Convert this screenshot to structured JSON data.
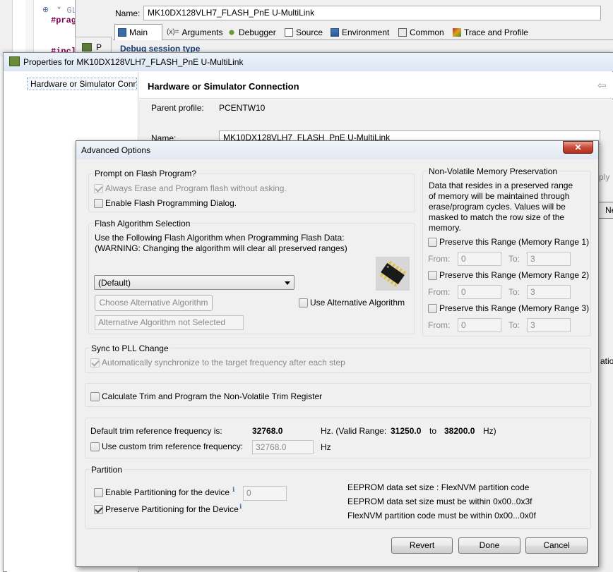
{
  "bg_editor": {
    "line1": "* GLOBAL.",
    "line2": "#pragma on",
    "line3": "#incl"
  },
  "launch_config": {
    "name_label": "Name:",
    "name_value": "MK10DX128VLH7_FLASH_PnE U-MultiLink",
    "tabs": [
      {
        "label": "Main",
        "icon": "main-tab-icon"
      },
      {
        "label": "Arguments",
        "icon": "arguments-icon"
      },
      {
        "label": "Debugger",
        "icon": "debugger-bug-icon"
      },
      {
        "label": "Source",
        "icon": "source-icon"
      },
      {
        "label": "Environment",
        "icon": "environment-icon"
      },
      {
        "label": "Common",
        "icon": "common-icon"
      },
      {
        "label": "Trace and Profile",
        "icon": "trace-icon"
      }
    ],
    "section_title": "Debug session type",
    "small_letter": "P"
  },
  "properties": {
    "title": "Properties for MK10DX128VLH7_FLASH_PnE U-MultiLink",
    "tree_item": "Hardware or Simulator Conn",
    "heading": "Hardware or Simulator Connection",
    "parent_profile_label": "Parent profile:",
    "parent_profile_value": "PCENTW10",
    "name_label": "Name:",
    "name_value": "MK10DX128VLH7_FLASH_PnE U-MultiLink",
    "right_edge_1": "ply",
    "right_edge_2": "Ne",
    "right_edge_3": "atio"
  },
  "dialog": {
    "title": "Advanced Options",
    "close_glyph": "✕",
    "prompt": {
      "title": "Prompt on Flash Program?",
      "always_erase": "Always Erase and Program flash without asking.",
      "enable_dialog": "Enable Flash Programming Dialog."
    },
    "algorithm": {
      "title": "Flash Algorithm Selection",
      "desc1": "Use the Following Flash Algorithm when Programming Flash Data:",
      "desc2": "(WARNING: Changing the algorithm will clear all preserved ranges)",
      "select_value": "(Default)",
      "choose_button": "Choose Alternative Algorithm",
      "use_alt": "Use Alternative Algorithm",
      "not_selected": "Alternative Algorithm not Selected"
    },
    "nvm": {
      "title": "Non-Volatile Memory Preservation",
      "desc": [
        "Data that resides in a preserved range",
        "of memory will be maintained through",
        "erase/program cycles. Values will be",
        "masked to match the row size of the",
        "memory."
      ],
      "ranges": [
        {
          "label": "Preserve this Range (Memory Range 1)",
          "from_label": "From:",
          "from": "0",
          "to_label": "To:",
          "to": "3"
        },
        {
          "label": "Preserve this Range (Memory Range 2)",
          "from_label": "From:",
          "from": "0",
          "to_label": "To:",
          "to": "3"
        },
        {
          "label": "Preserve this Range (Memory Range 3)",
          "from_label": "From:",
          "from": "0",
          "to_label": "To:",
          "to": "3"
        }
      ]
    },
    "pll": {
      "title": "Sync to PLL Change",
      "auto_sync": "Automatically synchronize to the target frequency after each step"
    },
    "trim": {
      "calc": "Calculate Trim and Program the Non-Volatile Trim Register",
      "default_label": "Default trim reference frequency is:",
      "default_value": "32768.0",
      "hz_valid": "Hz. (Valid Range:",
      "range_min": "31250.0",
      "to": "to",
      "range_max": "38200.0",
      "hz_close": "Hz)",
      "custom_label": "Use custom trim reference frequency:",
      "custom_value": "32768.0",
      "custom_unit": "Hz"
    },
    "partition": {
      "title": "Partition",
      "enable": "Enable Partitioning for the device",
      "enable_value": "0",
      "preserve": "Preserve Partitioning for the Device",
      "info1": "EEPROM data set size : FlexNVM partition code",
      "info2": "EEPROM data set size must be within 0x00..0x3f",
      "info3": "FlexNVM partition code must be within 0x00...0x0f"
    },
    "buttons": {
      "revert": "Revert",
      "done": "Done",
      "cancel": "Cancel"
    }
  }
}
